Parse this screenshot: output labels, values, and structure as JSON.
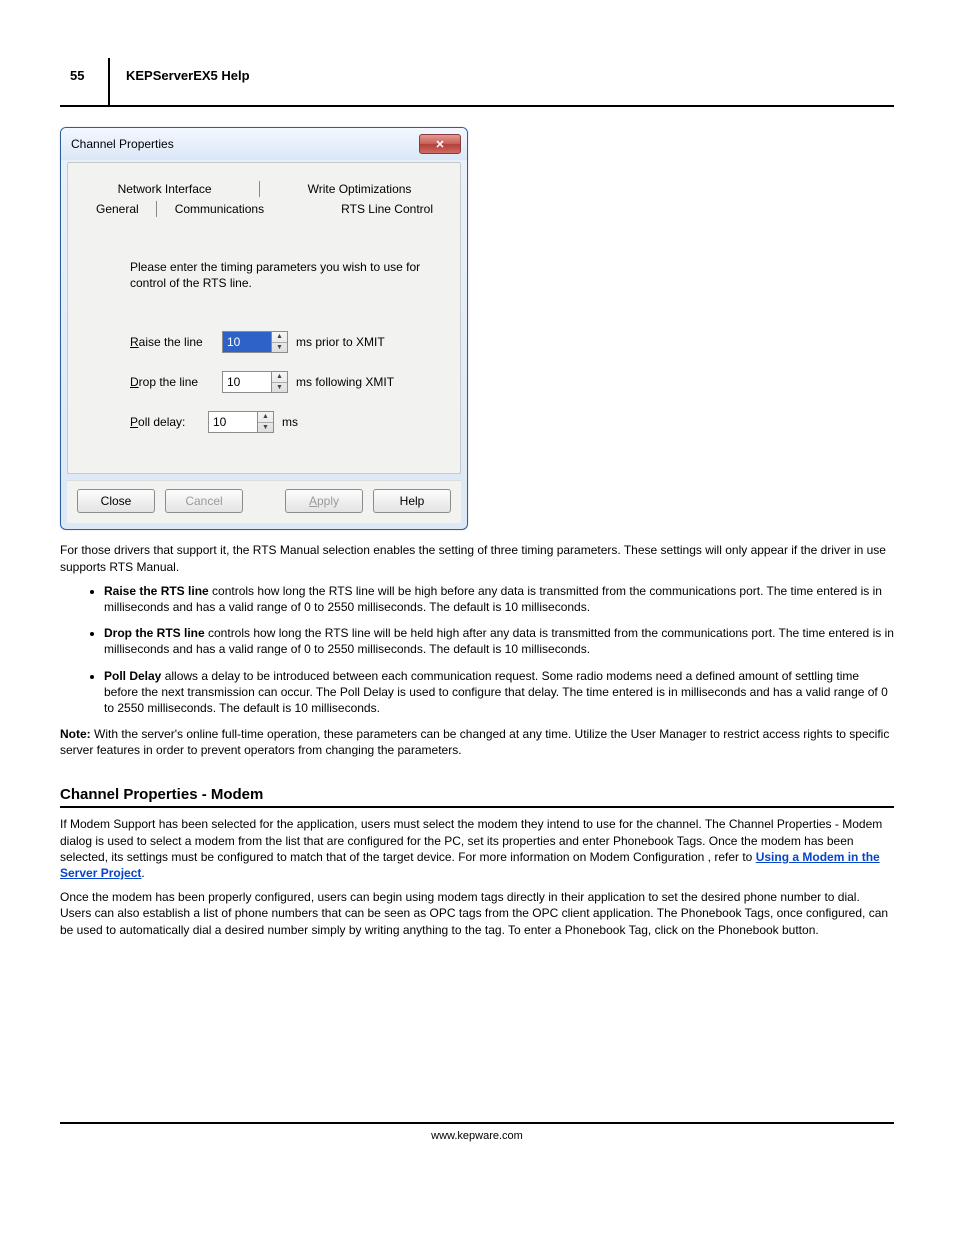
{
  "header": {
    "page_number": "55",
    "title": "KEPServerEX5 Help"
  },
  "dialog": {
    "title": "Channel Properties",
    "close_glyph": "✕",
    "tabs_row1": [
      "Network Interface",
      "Write Optimizations"
    ],
    "tabs_row2": [
      "General",
      "Communications",
      "RTS Line Control"
    ],
    "instruction": "Please enter the timing parameters you wish to use for control of the RTS line.",
    "fields": {
      "raise": {
        "label_pre": "R",
        "label_rest": "aise the line",
        "value": "10",
        "suffix": "ms prior to XMIT"
      },
      "drop": {
        "label_pre": "D",
        "label_rest": "rop the line",
        "value": "10",
        "suffix": "ms following XMIT"
      },
      "poll": {
        "label_pre": "P",
        "label_rest": "oll delay:",
        "value": "10",
        "suffix": "ms"
      }
    },
    "buttons": {
      "close": "Close",
      "cancel": "Cancel",
      "apply_pre": "A",
      "apply_rest": "pply",
      "help": "Help"
    }
  },
  "para_intro": "For those drivers that support it, the RTS Manual selection enables the setting of three timing parameters. These settings will only appear if the driver in use supports RTS Manual.",
  "bullets": [
    {
      "bold": "Raise the RTS line",
      "rest": " controls how long the RTS line will be high before any data is transmitted from the communications port. The time entered is in milliseconds and has a valid range of 0 to 2550 milliseconds. The default is 10 milliseconds."
    },
    {
      "bold": "Drop the RTS line",
      "rest": " controls how long the RTS line will be held high after any data is transmitted from the communications port. The time entered is in milliseconds and has a valid range of 0 to 2550 milliseconds. The default is 10 milliseconds."
    },
    {
      "bold": "Poll Delay",
      "rest": " allows a delay to be introduced between each communication request. Some radio modems need a defined amount of settling time before the next transmission can occur. The Poll Delay is used to configure that delay. The time entered is in milliseconds and has a valid range of 0 to 2550 milliseconds. The default is 10 milliseconds."
    }
  ],
  "note_label": "Note:",
  "note_body": " With the server's online full-time operation, these parameters can be changed at any time. Utilize the User Manager to restrict access rights to specific server features in order to prevent operators from changing the parameters.",
  "section2": {
    "title": "Channel Properties - Modem",
    "p1a": "If Modem Support has been selected for the application, users must select the modem they intend to use for the channel. The Channel Properties - Modem dialog is used to select a modem from the list that are configured for the PC, set its properties and enter Phonebook Tags. Once the modem has been selected, its settings must be configured to match that of the target device. For more information on Modem Configuration , refer to ",
    "link": "Using a Modem in the Server Project",
    "p1b": ".",
    "p2": "Once the modem has been properly configured, users can begin using modem tags directly in their application to set the desired phone number to dial. Users can also establish a list of phone numbers that can be seen as OPC tags from the OPC client application. The Phonebook Tags, once configured, can be used to automatically dial a desired number simply by writing anything to the tag. To enter a Phonebook Tag, click on the Phonebook button."
  },
  "footer": "www.kepware.com"
}
